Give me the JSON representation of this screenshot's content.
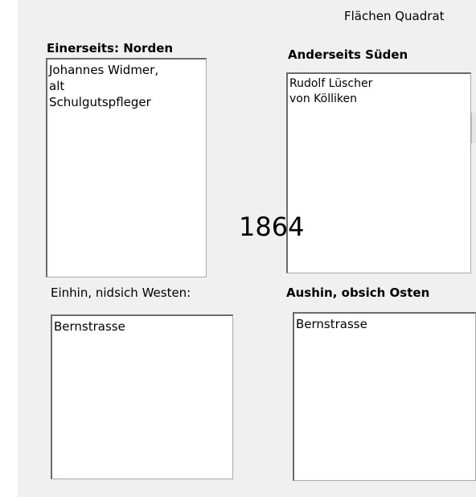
{
  "header": {
    "title": "Flächen Quadrat"
  },
  "overlay": {
    "year": "1864"
  },
  "fields": {
    "north": {
      "label": "Einerseits: Norden",
      "value": "Johannes Widmer,\nalt\nSchulgutspfleger"
    },
    "south": {
      "label": "Anderseits Süden",
      "value": "Rudolf Lüscher\nvon Kölliken"
    },
    "west": {
      "label": "Einhin, nidsich Westen:",
      "value": "Bernstrasse"
    },
    "east": {
      "label": "Aushin,  obsich Osten",
      "value": "Bernstrasse"
    }
  }
}
